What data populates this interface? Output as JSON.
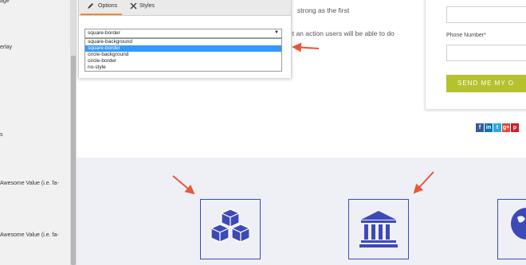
{
  "sidebar": {
    "labels": [
      "age",
      "erlay",
      "s",
      "Awesome Value (i.e. fa-",
      "Awesome Value (i.e. fa-"
    ]
  },
  "page": {
    "text_line_1": "strong as the first",
    "text_line_2": "nt an action users will be able to do"
  },
  "form": {
    "phone_label": "Phone Number*",
    "send_button": "SEND ME MY O"
  },
  "social": [
    {
      "label": "f",
      "icon": "facebook-icon",
      "color": "#3b5998"
    },
    {
      "label": "in",
      "icon": "linkedin-icon",
      "color": "#0e76a8"
    },
    {
      "label": "t",
      "icon": "twitter-icon",
      "color": "#2ea7e0"
    },
    {
      "label": "g+",
      "icon": "googleplus-icon",
      "color": "#dd4b39"
    },
    {
      "label": "p",
      "icon": "pinterest-icon",
      "color": "#cb2027"
    }
  ],
  "panel": {
    "tabs": [
      "Options",
      "Styles"
    ],
    "select_value": "square-border",
    "options": [
      "square-background",
      "square-border",
      "circle-background",
      "circle-border",
      "no-style"
    ],
    "selected_index": 1
  },
  "colors": {
    "accent_tab": "#f08a37",
    "annotation_arrow": "#e8573a",
    "feature_icon": "#3c4ab8",
    "button": "#b5c22d"
  }
}
